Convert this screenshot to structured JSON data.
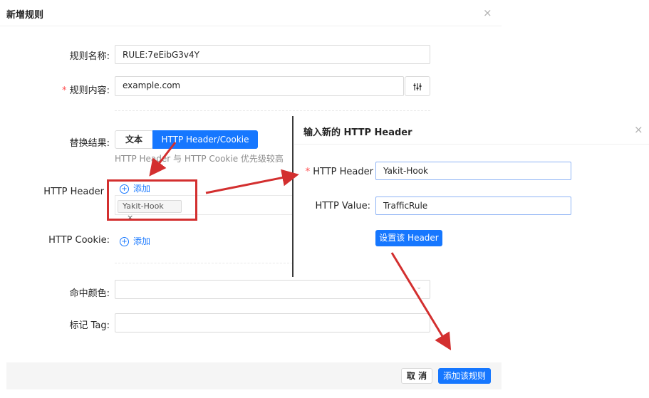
{
  "modal": {
    "title": "新增规则",
    "close_icon": "×",
    "fields": {
      "rule_name_label": "规则名称:",
      "rule_name_value": "RULE:7eEibG3v4Y",
      "rule_content_required": "*",
      "rule_content_label": "规则内容:",
      "rule_content_value": "example.com",
      "replace_result_label": "替换结果:",
      "replace_tab_text": "文本",
      "replace_tab_header": "HTTP Header/Cookie",
      "replace_hint": "HTTP Header 与 HTTP Cookie 优先级较高",
      "http_header_label": "HTTP Header",
      "add_label": "添加",
      "header_tag": "Yakit-Hook",
      "tag_close": "×",
      "http_cookie_label": "HTTP Cookie:",
      "cookie_add_label": "添加",
      "hit_color_label": "命中颜色:",
      "tag_label": "标记 Tag:"
    },
    "footer": {
      "cancel": "取 消",
      "submit": "添加该规则"
    }
  },
  "dialog": {
    "title": "输入新的 HTTP Header",
    "close_icon": "×",
    "header_required": "*",
    "header_label": "HTTP Header",
    "header_value": "Yakit-Hook",
    "value_label": "HTTP Value:",
    "value_value": "TrafficRule",
    "set_button": "设置该 Header"
  },
  "colors": {
    "primary": "#1677ff",
    "annotation": "#d32f2f",
    "required": "#ff4d4f"
  },
  "icons": {
    "close": "close-icon",
    "settings": "settings-sliders-icon",
    "add": "plus-circle-icon",
    "chevron": "chevron-down-icon"
  }
}
